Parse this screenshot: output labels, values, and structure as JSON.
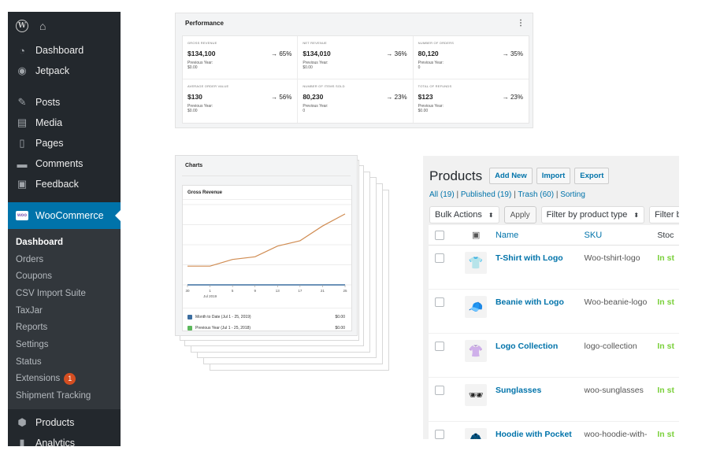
{
  "sidebar": {
    "top_icons": [
      "wordpress-logo-icon",
      "home-icon"
    ],
    "items_a": [
      {
        "label": "Dashboard",
        "icon": "dashboard-icon"
      },
      {
        "label": "Jetpack",
        "icon": "jetpack-icon"
      }
    ],
    "items_b": [
      {
        "label": "Posts",
        "icon": "pin-icon"
      },
      {
        "label": "Media",
        "icon": "media-icon"
      },
      {
        "label": "Pages",
        "icon": "pages-icon"
      },
      {
        "label": "Comments",
        "icon": "comments-icon"
      },
      {
        "label": "Feedback",
        "icon": "feedback-icon"
      }
    ],
    "woo": {
      "label": "WooCommerce",
      "badge": "woo"
    },
    "sub_items": [
      {
        "label": "Dashboard",
        "active": true
      },
      {
        "label": "Orders"
      },
      {
        "label": "Coupons"
      },
      {
        "label": "CSV Import Suite"
      },
      {
        "label": "TaxJar"
      },
      {
        "label": "Reports"
      },
      {
        "label": "Settings"
      },
      {
        "label": "Status"
      },
      {
        "label": "Extensions",
        "badge": "1"
      },
      {
        "label": "Shipment Tracking"
      }
    ],
    "items_c": [
      {
        "label": "Products",
        "icon": "products-icon"
      },
      {
        "label": "Analytics",
        "icon": "analytics-icon"
      }
    ]
  },
  "performance": {
    "title": "Performance",
    "menu_icon": "⋮",
    "cells": [
      {
        "label": "GROSS REVENUE",
        "value": "$134,100",
        "delta": "→ 65%",
        "prev_label": "Previous Year:",
        "prev_value": "$0.00"
      },
      {
        "label": "NET REVENUE",
        "value": "$134,010",
        "delta": "→ 36%",
        "prev_label": "Previous Year:",
        "prev_value": "$0.00"
      },
      {
        "label": "NUMBER OF ORDERS",
        "value": "80,120",
        "delta": "→ 35%",
        "prev_label": "Previous Year:",
        "prev_value": "0"
      },
      {
        "label": "AVERAGE ORDER VALUE",
        "value": "$130",
        "delta": "→ 56%",
        "prev_label": "Previous Year:",
        "prev_value": "$0.00"
      },
      {
        "label": "NUMBER OF ITEMS SOLD",
        "value": "80,230",
        "delta": "→ 23%",
        "prev_label": "Previous Year:",
        "prev_value": "0"
      },
      {
        "label": "TOTAL OF REFUNDS",
        "value": "$123",
        "delta": "→ 23%",
        "prev_label": "Previous Year:",
        "prev_value": "$0.00"
      }
    ]
  },
  "charts": {
    "section_title": "Charts",
    "card_title": "Gross Revenue",
    "legend": [
      {
        "label": "Month to Date (Jul 1 - 25, 2019)",
        "value": "$0.00",
        "color": "#3c6ea0"
      },
      {
        "label": "Previous Year (Jul 1 - 25, 2018)",
        "value": "$0.00",
        "color": "#5cb85c"
      }
    ]
  },
  "chart_data": {
    "type": "line",
    "x_tick_labels": [
      "30",
      "1",
      "5",
      "9",
      "13",
      "17",
      "21",
      "25"
    ],
    "x_sub_label": "Jul 2019",
    "series": [
      {
        "values": [
          14,
          14,
          19,
          21,
          29,
          33,
          44,
          53
        ],
        "color": "#d08c52"
      },
      {
        "values": [
          0,
          0,
          0,
          0,
          0,
          0,
          0,
          0
        ],
        "color": "#3c6ea0"
      }
    ],
    "ylim": [
      0,
      60
    ],
    "grid": true
  },
  "products": {
    "title": "Products",
    "buttons": [
      "Add New",
      "Import",
      "Export"
    ],
    "filters": {
      "all": "All (19)",
      "published": "Published (19)",
      "trash": "Trash (60)",
      "sorting": "Sorting",
      "sep": " | "
    },
    "bulk_actions": "Bulk Actions",
    "apply": "Apply",
    "filter_type": "Filter by product type",
    "filter_cut": "Filter by",
    "columns": {
      "name": "Name",
      "sku": "SKU",
      "stock": "Stoc"
    },
    "rows": [
      {
        "name": "T-Shirt with Logo",
        "sku": "Woo-tshirt-logo",
        "stock": "In st",
        "thumb": "👕"
      },
      {
        "name": "Beanie with Logo",
        "sku": "Woo-beanie-logo",
        "stock": "In st",
        "thumb": "🧢"
      },
      {
        "name": "Logo Collection",
        "sku": "logo-collection",
        "stock": "In st",
        "thumb": "👚"
      },
      {
        "name": "Sunglasses",
        "sku": "woo-sunglasses",
        "stock": "In st",
        "thumb": "🕶"
      },
      {
        "name": "Hoodie with Pocket",
        "sku": "woo-hoodie-with-pocket",
        "stock": "In st",
        "thumb": "🧥"
      }
    ]
  }
}
